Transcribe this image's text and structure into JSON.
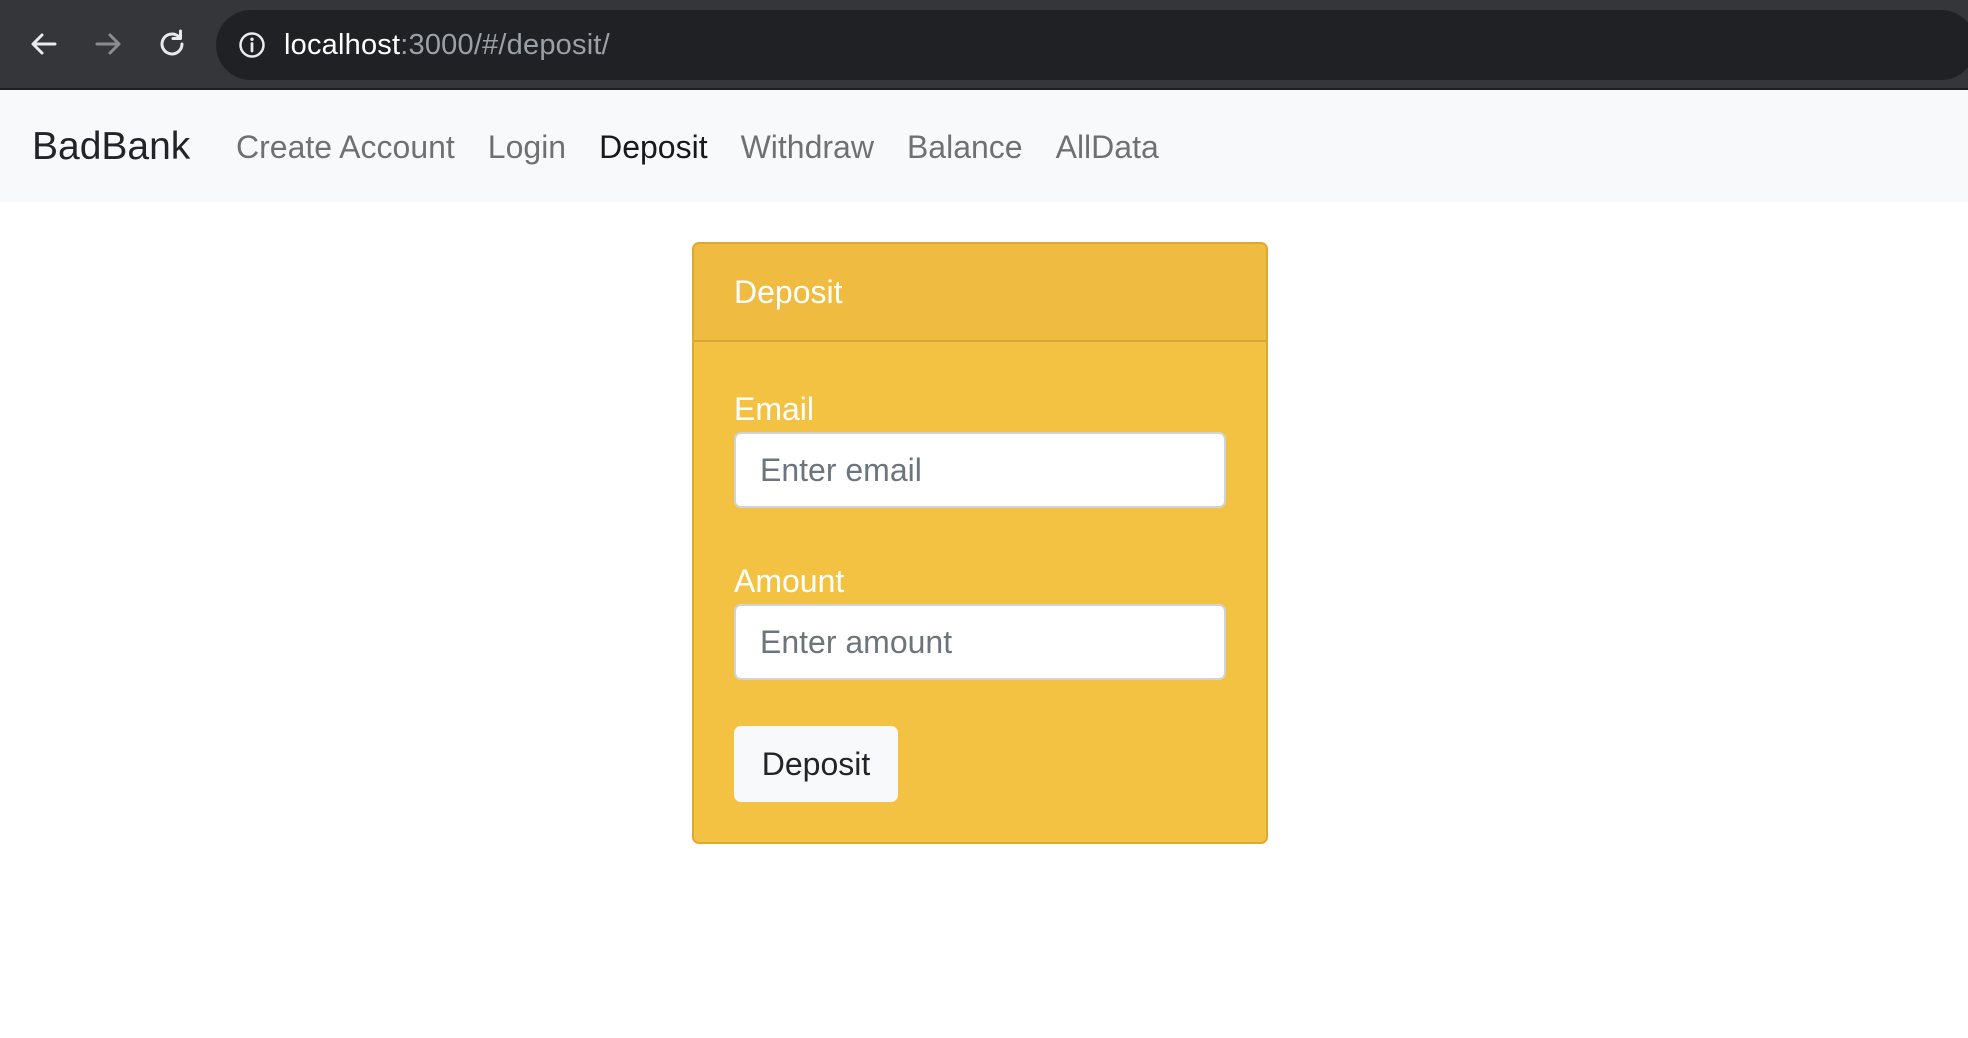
{
  "browser": {
    "url_host": "localhost",
    "url_rest": ":3000/#/deposit/",
    "back_icon": "back-arrow-icon",
    "forward_icon": "forward-arrow-icon",
    "reload_icon": "reload-icon",
    "info_icon": "info-icon"
  },
  "navbar": {
    "brand": "BadBank",
    "links": [
      {
        "label": "Create Account",
        "active": false
      },
      {
        "label": "Login",
        "active": false
      },
      {
        "label": "Deposit",
        "active": true
      },
      {
        "label": "Withdraw",
        "active": false
      },
      {
        "label": "Balance",
        "active": false
      },
      {
        "label": "AllData",
        "active": false
      }
    ]
  },
  "card": {
    "title": "Deposit",
    "email_label": "Email",
    "email_placeholder": "Enter email",
    "email_value": "",
    "amount_label": "Amount",
    "amount_placeholder": "Enter amount",
    "amount_value": "",
    "submit_label": "Deposit"
  },
  "colors": {
    "card_background": "#f4c242",
    "card_header": "#efbb41",
    "navbar_background": "#f8f9fa",
    "browser_chrome": "#35363a"
  }
}
